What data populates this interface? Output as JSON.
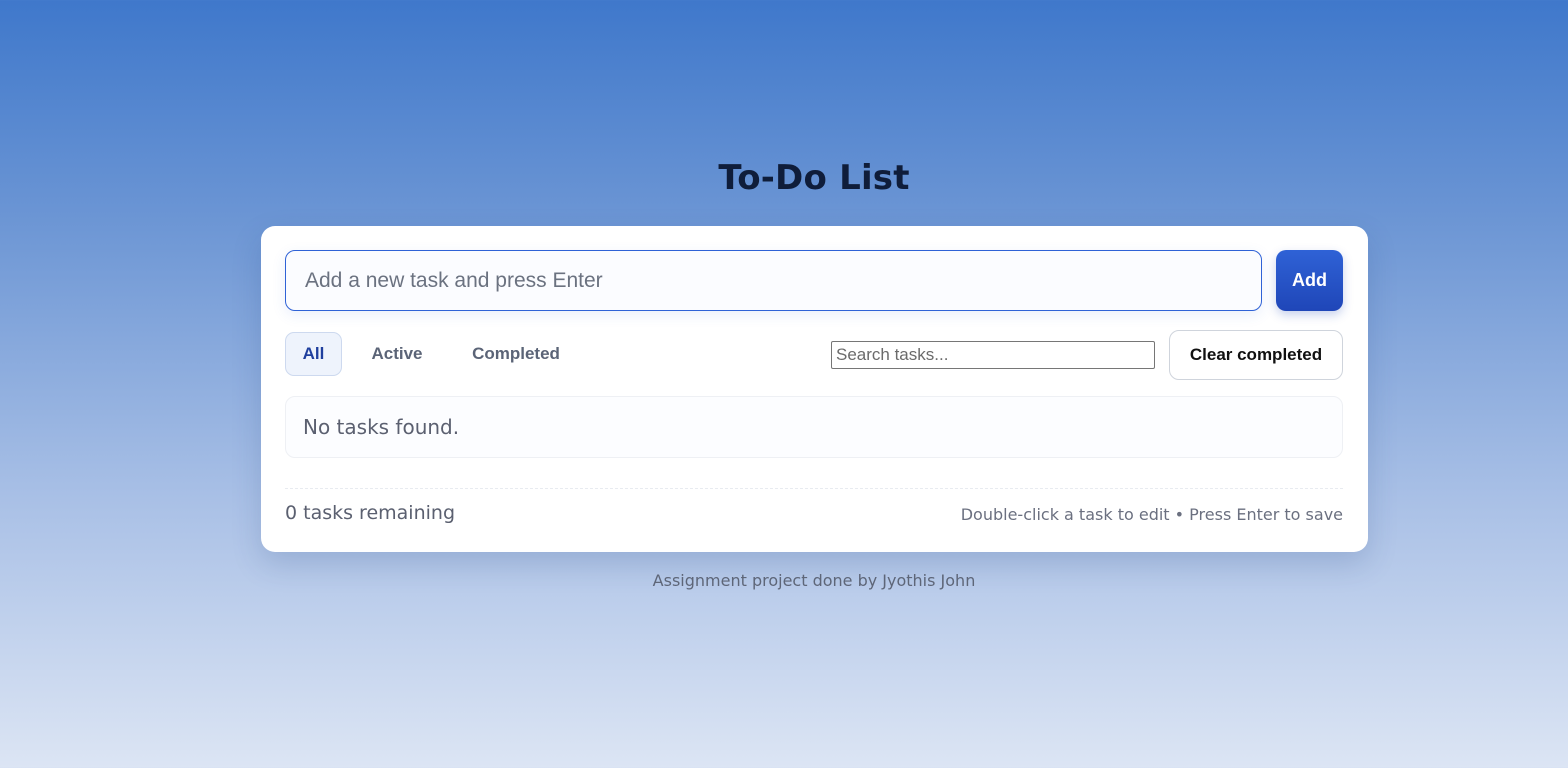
{
  "app": {
    "title": "To-Do List"
  },
  "new_task": {
    "placeholder": "Add a new task and press Enter",
    "value": "",
    "add_label": "Add"
  },
  "filters": {
    "items": [
      {
        "label": "All",
        "active": true
      },
      {
        "label": "Active",
        "active": false
      },
      {
        "label": "Completed",
        "active": false
      }
    ]
  },
  "search": {
    "placeholder": "Search tasks...",
    "value": ""
  },
  "clear_completed_label": "Clear completed",
  "task_list": {
    "empty_message": "No tasks found."
  },
  "status": {
    "remaining_text": "0 tasks remaining",
    "hint_text": "Double-click a task to edit • Press Enter to save"
  },
  "footer": {
    "credit": "Assignment project done by Jyothis John"
  },
  "colors": {
    "accent": "#2f62d6",
    "background_top": "#3f78cb",
    "background_bottom": "#dce5f4"
  }
}
